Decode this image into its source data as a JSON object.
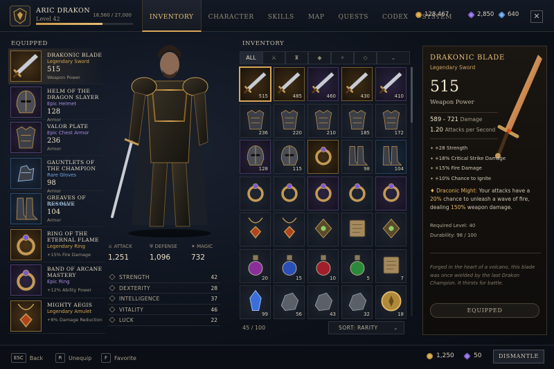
{
  "player": {
    "name": "ARIC DRAKON",
    "level": "Level 42",
    "xp_text": "18,560 / 27,000",
    "xp_fraction": 0.687
  },
  "tabs": [
    "INVENTORY",
    "CHARACTER",
    "SKILLS",
    "MAP",
    "QUESTS",
    "CODEX",
    "SYSTEM"
  ],
  "active_tab": "INVENTORY",
  "currencies": {
    "gold": "128,467",
    "shards": "2,850",
    "gems": "640"
  },
  "equipped": {
    "title": "EQUIPPED",
    "items": [
      {
        "name": "DRAKONIC BLADE",
        "rarity": "Legendary Sword",
        "value": "515",
        "stat": "Weapon Power",
        "tier": "leg",
        "icon": "sword-icon"
      },
      {
        "name": "HELM OF THE DRAGON SLAYER",
        "rarity": "Epic Helmet",
        "value": "128",
        "stat": "Armor",
        "tier": "epic",
        "icon": "helmet-icon"
      },
      {
        "name": "VALOR PLATE",
        "rarity": "Epic Chest Armor",
        "value": "236",
        "stat": "Armor",
        "tier": "epic",
        "icon": "chest-armor-icon"
      },
      {
        "name": "GAUNTLETS OF THE CHAMPION",
        "rarity": "Rare Gloves",
        "value": "98",
        "stat": "Armor",
        "tier": "rare",
        "icon": "gauntlets-icon"
      },
      {
        "name": "GREAVES OF RESOLVE",
        "rarity": "Rare Boots",
        "value": "104",
        "stat": "Armor",
        "tier": "rare",
        "icon": "boots-icon"
      },
      {
        "name": "RING OF THE ETERNAL FLAME",
        "rarity": "Legendary Ring",
        "value": "",
        "stat": "+15% Fire Damage",
        "tier": "leg",
        "icon": "ring-icon"
      },
      {
        "name": "BAND OF ARCANE MASTERY",
        "rarity": "Epic Ring",
        "value": "",
        "stat": "+12% Ability Power",
        "tier": "epic",
        "icon": "ring-icon"
      },
      {
        "name": "MIGHTY AEGIS",
        "rarity": "Legendary Amulet",
        "value": "",
        "stat": "+8% Damage Reduction",
        "tier": "leg",
        "icon": "amulet-icon"
      }
    ]
  },
  "combat": {
    "attack_label": "ATTACK",
    "attack": "1,251",
    "defense_label": "DEFENSE",
    "defense": "1,096",
    "magic_label": "MAGIC",
    "magic": "732"
  },
  "attributes": [
    {
      "name": "STRENGTH",
      "value": "42"
    },
    {
      "name": "DEXTERITY",
      "value": "28"
    },
    {
      "name": "INTELLIGENCE",
      "value": "37"
    },
    {
      "name": "VITALITY",
      "value": "46"
    },
    {
      "name": "LUCK",
      "value": "22"
    }
  ],
  "inventory": {
    "title": "INVENTORY",
    "filters": [
      "ALL",
      "⚔",
      "♜",
      "◆",
      "✧",
      "◇"
    ],
    "capacity": "45 / 100",
    "sort": "SORT: RARITY",
    "slots": [
      {
        "icon": "sword-icon",
        "count": "515",
        "tier": "leg",
        "selected": true
      },
      {
        "icon": "sword-icon",
        "count": "485",
        "tier": "leg"
      },
      {
        "icon": "sword-icon",
        "count": "460",
        "tier": "epic"
      },
      {
        "icon": "sword-icon",
        "count": "430",
        "tier": "leg"
      },
      {
        "icon": "sword-icon",
        "count": "410",
        "tier": "epic"
      },
      {
        "icon": "chest-armor-icon",
        "count": "236",
        "tier": ""
      },
      {
        "icon": "chest-armor-icon",
        "count": "220",
        "tier": ""
      },
      {
        "icon": "chest-armor-icon",
        "count": "210",
        "tier": ""
      },
      {
        "icon": "chest-armor-icon",
        "count": "185",
        "tier": ""
      },
      {
        "icon": "chest-armor-icon",
        "count": "172",
        "tier": ""
      },
      {
        "icon": "helmet-icon",
        "count": "128",
        "tier": "epic"
      },
      {
        "icon": "helmet-icon",
        "count": "115",
        "tier": ""
      },
      {
        "icon": "ring-icon",
        "count": "",
        "tier": "leg"
      },
      {
        "icon": "boots-icon",
        "count": "98",
        "tier": ""
      },
      {
        "icon": "boots-icon",
        "count": "104",
        "tier": "rare"
      },
      {
        "icon": "ring-icon",
        "count": "",
        "tier": ""
      },
      {
        "icon": "ring-icon",
        "count": "",
        "tier": ""
      },
      {
        "icon": "ring-icon",
        "count": "",
        "tier": "epic"
      },
      {
        "icon": "ring-icon",
        "count": "",
        "tier": ""
      },
      {
        "icon": "ring-icon",
        "count": "",
        "tier": "epic"
      },
      {
        "icon": "amulet-icon",
        "count": "",
        "tier": ""
      },
      {
        "icon": "amulet-icon",
        "count": "",
        "tier": ""
      },
      {
        "icon": "rune-icon",
        "count": "",
        "tier": ""
      },
      {
        "icon": "scroll-icon",
        "count": "",
        "tier": ""
      },
      {
        "icon": "rune-icon",
        "count": "",
        "tier": ""
      },
      {
        "icon": "potion-icon",
        "count": "20",
        "tier": ""
      },
      {
        "icon": "potion-icon",
        "count": "15",
        "tier": ""
      },
      {
        "icon": "potion-icon",
        "count": "10",
        "tier": ""
      },
      {
        "icon": "potion-icon",
        "count": "5",
        "tier": ""
      },
      {
        "icon": "scroll-icon",
        "count": "7",
        "tier": ""
      },
      {
        "icon": "crystal-icon",
        "count": "99",
        "tier": ""
      },
      {
        "icon": "ore-icon",
        "count": "56",
        "tier": ""
      },
      {
        "icon": "ore-icon",
        "count": "43",
        "tier": ""
      },
      {
        "icon": "ore-icon",
        "count": "32",
        "tier": ""
      },
      {
        "icon": "coin-icon",
        "count": "18",
        "tier": ""
      }
    ]
  },
  "detail": {
    "name": "DRAKONIC BLADE",
    "rarity": "Legendary Sword",
    "value": "515",
    "value_label": "Weapon Power",
    "damage": "589 - 721",
    "damage_label": "Damage",
    "aps": "1.20",
    "aps_label": "Attacks per Second",
    "bonuses": [
      "+28 Strength",
      "+18% Critical Strike Damage",
      "+15% Fire Damage",
      "+10% Chance to Ignite"
    ],
    "might_title": "Draconic Might:",
    "might_a": "Your attacks have a",
    "might_b": "20%",
    "might_c": "chance to unleash a wave of fire, dealing",
    "might_d": "150%",
    "might_e": "weapon damage.",
    "required_level": "Required Level: 40",
    "durability": "Durability: 98 / 100",
    "lore": "Forged in the heart of a volcano, this blade was once wielded by the last Drakon Champion. It thirsts for battle.",
    "equipped_label": "EQUIPPED"
  },
  "footer": {
    "esc_key": "ESC",
    "esc_label": "Back",
    "r_key": "R",
    "r_label": "Unequip",
    "f_key": "F",
    "f_label": "Favorite",
    "gold": "1,250",
    "shards": "50",
    "dismantle": "DISMANTLE"
  },
  "colors": {
    "accent": "#d8a75a",
    "legendary": "#d7a64f",
    "epic": "#a98be0",
    "rare": "#6fa6e6"
  }
}
